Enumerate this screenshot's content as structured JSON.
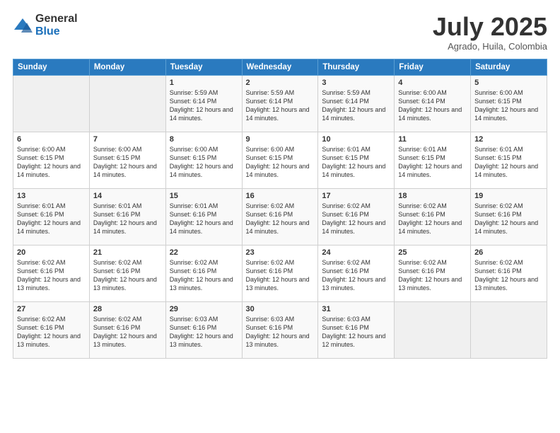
{
  "logo": {
    "general": "General",
    "blue": "Blue"
  },
  "title": "July 2025",
  "location": "Agrado, Huila, Colombia",
  "days_of_week": [
    "Sunday",
    "Monday",
    "Tuesday",
    "Wednesday",
    "Thursday",
    "Friday",
    "Saturday"
  ],
  "weeks": [
    [
      {
        "num": "",
        "info": ""
      },
      {
        "num": "",
        "info": ""
      },
      {
        "num": "1",
        "info": "Sunrise: 5:59 AM\nSunset: 6:14 PM\nDaylight: 12 hours and 14 minutes."
      },
      {
        "num": "2",
        "info": "Sunrise: 5:59 AM\nSunset: 6:14 PM\nDaylight: 12 hours and 14 minutes."
      },
      {
        "num": "3",
        "info": "Sunrise: 5:59 AM\nSunset: 6:14 PM\nDaylight: 12 hours and 14 minutes."
      },
      {
        "num": "4",
        "info": "Sunrise: 6:00 AM\nSunset: 6:14 PM\nDaylight: 12 hours and 14 minutes."
      },
      {
        "num": "5",
        "info": "Sunrise: 6:00 AM\nSunset: 6:15 PM\nDaylight: 12 hours and 14 minutes."
      }
    ],
    [
      {
        "num": "6",
        "info": "Sunrise: 6:00 AM\nSunset: 6:15 PM\nDaylight: 12 hours and 14 minutes."
      },
      {
        "num": "7",
        "info": "Sunrise: 6:00 AM\nSunset: 6:15 PM\nDaylight: 12 hours and 14 minutes."
      },
      {
        "num": "8",
        "info": "Sunrise: 6:00 AM\nSunset: 6:15 PM\nDaylight: 12 hours and 14 minutes."
      },
      {
        "num": "9",
        "info": "Sunrise: 6:00 AM\nSunset: 6:15 PM\nDaylight: 12 hours and 14 minutes."
      },
      {
        "num": "10",
        "info": "Sunrise: 6:01 AM\nSunset: 6:15 PM\nDaylight: 12 hours and 14 minutes."
      },
      {
        "num": "11",
        "info": "Sunrise: 6:01 AM\nSunset: 6:15 PM\nDaylight: 12 hours and 14 minutes."
      },
      {
        "num": "12",
        "info": "Sunrise: 6:01 AM\nSunset: 6:15 PM\nDaylight: 12 hours and 14 minutes."
      }
    ],
    [
      {
        "num": "13",
        "info": "Sunrise: 6:01 AM\nSunset: 6:16 PM\nDaylight: 12 hours and 14 minutes."
      },
      {
        "num": "14",
        "info": "Sunrise: 6:01 AM\nSunset: 6:16 PM\nDaylight: 12 hours and 14 minutes."
      },
      {
        "num": "15",
        "info": "Sunrise: 6:01 AM\nSunset: 6:16 PM\nDaylight: 12 hours and 14 minutes."
      },
      {
        "num": "16",
        "info": "Sunrise: 6:02 AM\nSunset: 6:16 PM\nDaylight: 12 hours and 14 minutes."
      },
      {
        "num": "17",
        "info": "Sunrise: 6:02 AM\nSunset: 6:16 PM\nDaylight: 12 hours and 14 minutes."
      },
      {
        "num": "18",
        "info": "Sunrise: 6:02 AM\nSunset: 6:16 PM\nDaylight: 12 hours and 14 minutes."
      },
      {
        "num": "19",
        "info": "Sunrise: 6:02 AM\nSunset: 6:16 PM\nDaylight: 12 hours and 14 minutes."
      }
    ],
    [
      {
        "num": "20",
        "info": "Sunrise: 6:02 AM\nSunset: 6:16 PM\nDaylight: 12 hours and 13 minutes."
      },
      {
        "num": "21",
        "info": "Sunrise: 6:02 AM\nSunset: 6:16 PM\nDaylight: 12 hours and 13 minutes."
      },
      {
        "num": "22",
        "info": "Sunrise: 6:02 AM\nSunset: 6:16 PM\nDaylight: 12 hours and 13 minutes."
      },
      {
        "num": "23",
        "info": "Sunrise: 6:02 AM\nSunset: 6:16 PM\nDaylight: 12 hours and 13 minutes."
      },
      {
        "num": "24",
        "info": "Sunrise: 6:02 AM\nSunset: 6:16 PM\nDaylight: 12 hours and 13 minutes."
      },
      {
        "num": "25",
        "info": "Sunrise: 6:02 AM\nSunset: 6:16 PM\nDaylight: 12 hours and 13 minutes."
      },
      {
        "num": "26",
        "info": "Sunrise: 6:02 AM\nSunset: 6:16 PM\nDaylight: 12 hours and 13 minutes."
      }
    ],
    [
      {
        "num": "27",
        "info": "Sunrise: 6:02 AM\nSunset: 6:16 PM\nDaylight: 12 hours and 13 minutes."
      },
      {
        "num": "28",
        "info": "Sunrise: 6:02 AM\nSunset: 6:16 PM\nDaylight: 12 hours and 13 minutes."
      },
      {
        "num": "29",
        "info": "Sunrise: 6:03 AM\nSunset: 6:16 PM\nDaylight: 12 hours and 13 minutes."
      },
      {
        "num": "30",
        "info": "Sunrise: 6:03 AM\nSunset: 6:16 PM\nDaylight: 12 hours and 13 minutes."
      },
      {
        "num": "31",
        "info": "Sunrise: 6:03 AM\nSunset: 6:16 PM\nDaylight: 12 hours and 12 minutes."
      },
      {
        "num": "",
        "info": ""
      },
      {
        "num": "",
        "info": ""
      }
    ]
  ]
}
